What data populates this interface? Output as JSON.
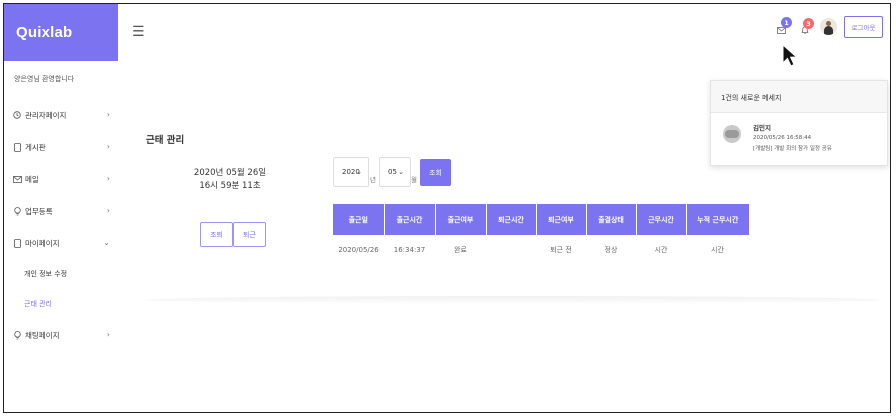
{
  "brand": "Quixlab",
  "sidebar": {
    "welcome": "양은영님 환영합니다",
    "items": [
      {
        "label": "관리자페이지",
        "icon": "clock-icon",
        "chevron": "›"
      },
      {
        "label": "게시판",
        "icon": "document-icon",
        "chevron": "›"
      },
      {
        "label": "메일",
        "icon": "mail-icon",
        "chevron": "›"
      },
      {
        "label": "업무등록",
        "icon": "bulb-icon",
        "chevron": "›"
      },
      {
        "label": "마이페이지",
        "icon": "document-icon",
        "chevron": "⌄"
      },
      {
        "label": "채팅페이지",
        "icon": "bulb-icon",
        "chevron": "›"
      }
    ],
    "subitems": [
      {
        "label": "개인 정보 수정"
      },
      {
        "label": "근태 관리"
      }
    ]
  },
  "header": {
    "mail_badge": "1",
    "bell_badge": "3",
    "logout_label": "로그아웃"
  },
  "messages": {
    "heading": "1건의 새로운 메세지",
    "items": [
      {
        "name": "김민지",
        "time": "2020/05/26 16:58:44",
        "text": "[개발팀] 개발 회의 참가 일정 공유"
      }
    ]
  },
  "main": {
    "title": "근태 관리",
    "date_line1": "2020년 05월 26일",
    "date_line2": "16시 59분 11초",
    "checkout_label": "조퇴",
    "leave_label": "퇴근",
    "year_value": "2020",
    "year_unit": "년",
    "month_value": "05",
    "month_unit": "월",
    "view_label": "조회",
    "table": {
      "headers": [
        "출근일",
        "출근시간",
        "출근여부",
        "퇴근시간",
        "퇴근여부",
        "출결상태",
        "근무시간",
        "누적 근무시간"
      ],
      "rows": [
        [
          "2020/05/26",
          "16:34:37",
          "완료",
          "",
          "퇴근 전",
          "정상",
          "시간",
          "시간"
        ]
      ]
    }
  },
  "colors": {
    "accent": "#7b73f0",
    "badge_mail": "#7b73f0",
    "badge_bell": "#f26b6b"
  }
}
